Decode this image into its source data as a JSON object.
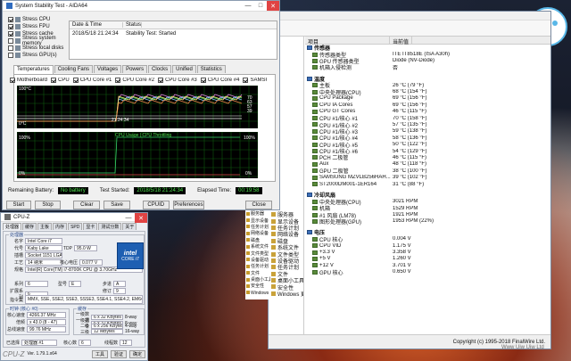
{
  "desktop": {
    "mascot_text": "92e",
    "watermark": "Www Uiw Uiw Ltd"
  },
  "stability": {
    "title": "System Stability Test - AIDA64",
    "stress_options": [
      {
        "label": "Stress CPU",
        "checked": true
      },
      {
        "label": "Stress FPU",
        "checked": true
      },
      {
        "label": "Stress cache",
        "checked": true
      },
      {
        "label": "Stress system memory",
        "checked": false
      },
      {
        "label": "Stress local disks",
        "checked": false
      },
      {
        "label": "Stress GPU(s)",
        "checked": false
      }
    ],
    "log_headers": [
      "Date & Time",
      "Status"
    ],
    "log_rows": [
      {
        "time": "2018/5/18 21:24:34",
        "status": "Stability Test: Started"
      }
    ],
    "tabs": [
      "Temperatures",
      "Cooling Fans",
      "Voltages",
      "Powers",
      "Clocks",
      "Unified",
      "Statistics"
    ],
    "legend": [
      "Motherboard",
      "CPU",
      "CPU Core #1",
      "CPU Core #2",
      "CPU Core #3",
      "CPU Core #4",
      "SAMSUNG MZVLB256HAHQ-000L7"
    ],
    "temp_graph": {
      "y_top": "100°C",
      "y_bottom": "0°C",
      "time_label": "21:24:34",
      "right_labels": [
        "70",
        "63",
        "57",
        "39"
      ]
    },
    "usage_graph": {
      "title": "CPU Usage | CPU Throttling",
      "y_top": "100%",
      "y_bottom": "0%",
      "right_top": "100%",
      "right_bottom": "0%"
    },
    "remaining_battery_label": "Remaining Battery:",
    "remaining_battery_value": "No battery",
    "test_started_label": "Test Started:",
    "test_started_value": "2018/5/18 21:24:34",
    "elapsed_label": "Elapsed Time:",
    "elapsed_value": "00:19:58",
    "buttons": [
      "Start",
      "Stop",
      "Clear",
      "Save",
      "CPUID",
      "Preferences",
      "Close"
    ]
  },
  "aida": {
    "columns": [
      "项目",
      "当前值"
    ],
    "tree": [
      "服务器",
      "显示设备",
      "任务计划",
      "网络设备",
      "磁盘",
      "系统文件",
      "文件类型",
      "设备驱动",
      "任务计划",
      "文件",
      "桌面小工具",
      "安全性",
      "Windows 更新"
    ],
    "sections": [
      {
        "group": "传感器",
        "rows": [
          {
            "name": "传感器类型",
            "value": "ITE IT8518E (ISA A30h)"
          },
          {
            "name": "GPU 传感器类型",
            "value": "Diode  (NV-Diode)"
          },
          {
            "name": "机箱入侵检测",
            "value": "否"
          }
        ]
      },
      {
        "group": "温度",
        "rows": [
          {
            "name": "主板",
            "value": "26 °C  (79 °F)"
          },
          {
            "name": "中央处理器(CPU)",
            "value": "68 °C  (154 °F)"
          },
          {
            "name": "CPU Package",
            "value": "69 °C  (156 °F)"
          },
          {
            "name": "CPU IA Cores",
            "value": "69 °C  (156 °F)"
          },
          {
            "name": "CPU GT Cores",
            "value": "46 °C  (115 °F)"
          },
          {
            "name": "CPU #1/核心 #1",
            "value": "70 °C  (158 °F)"
          },
          {
            "name": "CPU #1/核心 #2",
            "value": "57 °C  (135 °F)"
          },
          {
            "name": "CPU #1/核心 #3",
            "value": "59 °C  (138 °F)"
          },
          {
            "name": "CPU #1/核心 #4",
            "value": "58 °C  (136 °F)"
          },
          {
            "name": "CPU #1/核心 #5",
            "value": "50 °C  (122 °F)"
          },
          {
            "name": "CPU #1/核心 #6",
            "value": "54 °C  (129 °F)"
          },
          {
            "name": "PCH 二极管",
            "value": "46 °C  (115 °F)"
          },
          {
            "name": "Aux",
            "value": "48 °C  (118 °F)"
          },
          {
            "name": "GPU 二极管",
            "value": "38 °C  (100 °F)"
          },
          {
            "name": "SAMSUNG MZVLB256HAH...",
            "value": "39 °C  (102 °F)"
          },
          {
            "name": "ST2000DM001-1ER164",
            "value": "31 °C  (88 °F)"
          }
        ]
      },
      {
        "group": "冷却风扇",
        "rows": [
          {
            "name": "中央处理器(CPU)",
            "value": "3021 RPM"
          },
          {
            "name": "机箱",
            "value": "1529 RPM"
          },
          {
            "name": "#1 风扇 (LM78)",
            "value": "1921 RPM"
          },
          {
            "name": "图形处理器(GPU)",
            "value": "1953 RPM  (22%)"
          }
        ]
      },
      {
        "group": "电压",
        "rows": [
          {
            "name": "CPU 核心",
            "value": "0.004 V"
          },
          {
            "name": "CPU VID",
            "value": "1.175 V"
          },
          {
            "name": "+3.3 V",
            "value": "3.358 V"
          },
          {
            "name": "+5 V",
            "value": "1.260 V"
          },
          {
            "name": "+12 V",
            "value": "3.701 V"
          },
          {
            "name": "GPU 核心",
            "value": "0.650 V"
          }
        ]
      }
    ],
    "copyright": "Copyright (c) 1995-2018 FinalWire Ltd."
  },
  "cpuz": {
    "title": "CPU-Z",
    "tabs": [
      "处理器",
      "缓存",
      "主板",
      "内存",
      "SPD",
      "显卡",
      "测试分数",
      "关于"
    ],
    "processor_legend": "处理器",
    "fields": [
      {
        "k": "名字",
        "v": "Intel Core i7"
      },
      {
        "k": "代号",
        "v": "Kaby Lake"
      },
      {
        "k": "插槽",
        "v": "Socket 1151 LGA"
      },
      {
        "k": "工艺",
        "v": "14 纳米"
      },
      {
        "k": "规格",
        "v": "Intel(R) Core(TM) i7-8700K CPU @ 3.70GHz"
      },
      {
        "k": "系列",
        "v": "6"
      },
      {
        "k": "扩展系列",
        "v": "6"
      },
      {
        "k": "指令集",
        "v": "MMX, SSE, SSE2, SSE3, SSSE3, SSE4.1, SSE4.2, EM64T, VT-x, AES, AVX, AVX2, FMA3, TSX"
      }
    ],
    "tdp_label": "TDP",
    "tdp_value": "95.0 W",
    "voltage_label": "核心电压",
    "voltage_value": "0.077 V",
    "model_label": "型号",
    "model_value": "E",
    "stepping_label": "步进",
    "stepping_value": "A",
    "revision_label": "修订",
    "revision_value": "9",
    "intel_badge": "intel",
    "intel_sub": "CORE i7",
    "clock_legend": "时钟 (核心 #0)",
    "clock_fields": [
      {
        "k": "核心速度",
        "v": "4266.37 MHz"
      },
      {
        "k": "倍频",
        "v": "x 43.0 (8 - 47)"
      },
      {
        "k": "总线速度",
        "v": "99.76 MHz"
      }
    ],
    "cache_legend": "缓存",
    "cache_fields": [
      {
        "k": "一级数据",
        "v": "6 x 32 KBytes",
        "w": "8-way"
      },
      {
        "k": "一级指令",
        "v": "6 x 32 KBytes",
        "w": "8-way"
      },
      {
        "k": "二级",
        "v": "6 x 256 KBytes",
        "w": "4-way"
      },
      {
        "k": "三级",
        "v": "12 MBytes",
        "w": "16-way"
      }
    ],
    "selection_label": "已选择",
    "selection_value": "处理器 #1",
    "cores_label": "核心数",
    "cores_value": "6",
    "threads_label": "线程数",
    "threads_value": "12",
    "bottom_logo": "CPU-Z",
    "version": "Ver. 1.79.1.x64",
    "tools_button": "工具",
    "validate_button": "验证",
    "ok_button": "确定"
  }
}
